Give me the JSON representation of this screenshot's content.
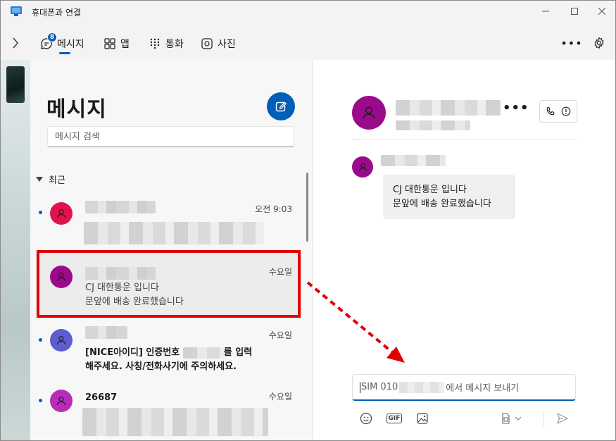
{
  "window": {
    "title": "휴대폰과 연결",
    "controls": [
      "minimize-icon",
      "maximize-icon",
      "close-icon"
    ]
  },
  "nav": {
    "tabs": [
      {
        "label": "메시지",
        "icon": "chat-icon",
        "badge": "8",
        "active": true
      },
      {
        "label": "앱",
        "icon": "apps-icon"
      },
      {
        "label": "통화",
        "icon": "dialpad-icon"
      },
      {
        "label": "사진",
        "icon": "photos-icon"
      }
    ]
  },
  "list": {
    "title": "메시지",
    "search_placeholder": "메시지 검색",
    "section_label": "최근",
    "conversations": [
      {
        "time": "오전 9:03",
        "unread": true,
        "avatar_color": "#e0134e"
      },
      {
        "time": "수요일",
        "preview": "CJ 대한통운 입니다\n문앞에 배송 완료했습니다",
        "selected": true,
        "avatar_color": "#9c0a8c"
      },
      {
        "time": "수요일",
        "unread": true,
        "preview_before": "[NICE아이디] 인증번호 ",
        "preview_after": "를 입력\n해주세요. 사칭/전화사기에 주의하세요.",
        "avatar_color": "#5e5ccf"
      },
      {
        "name": "26687",
        "time": "수요일",
        "unread": true,
        "avatar_color": "#b52dba"
      }
    ]
  },
  "detail": {
    "message": "CJ 대한통운 입니다\n문앞에 배송 완료했습니다",
    "compose_prefix": "SIM 010",
    "compose_suffix": "에서 메시지 보내기"
  },
  "colors": {
    "accent": "#005fb8",
    "highlight": "#e00000"
  }
}
